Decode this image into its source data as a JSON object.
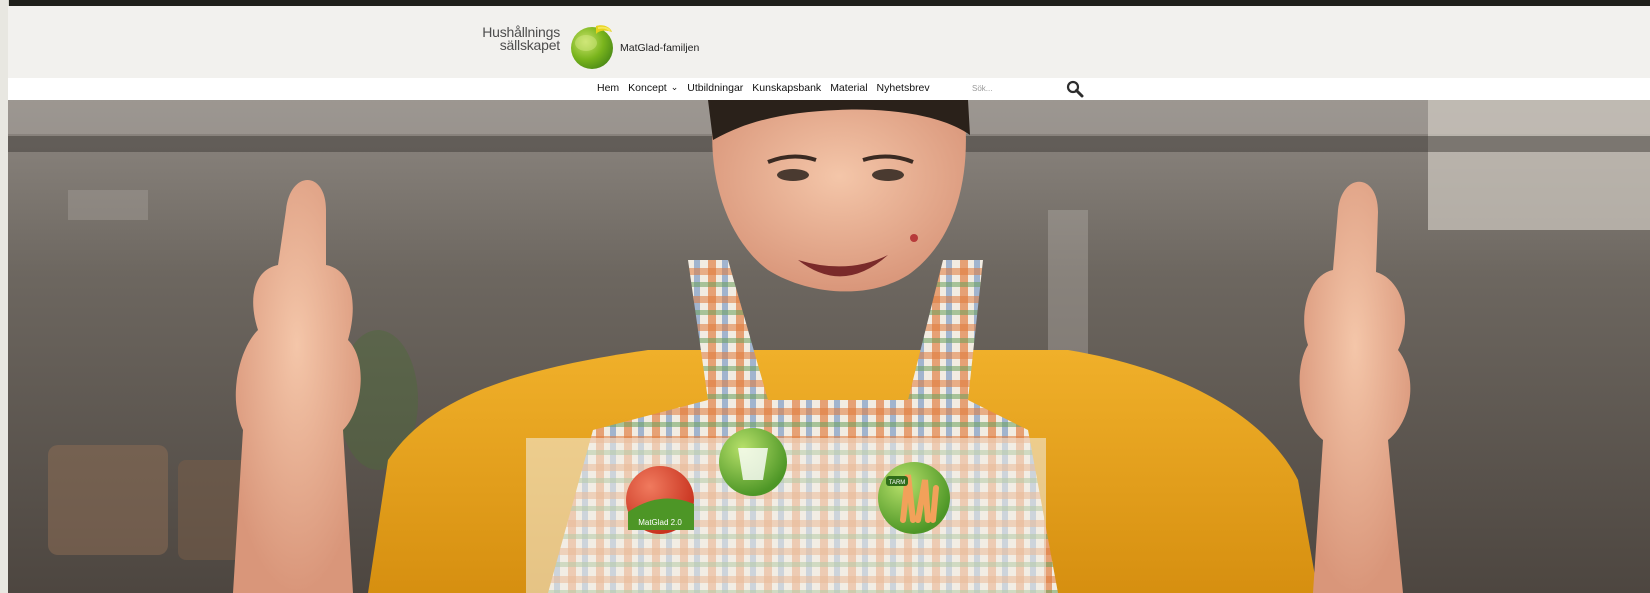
{
  "logo": {
    "org_line1": "Hushållnings",
    "org_line2": "sällskapet",
    "site_name": "MatGlad-familjen"
  },
  "nav": {
    "items": [
      {
        "label": "Hem"
      },
      {
        "label": "Koncept",
        "has_dropdown": true
      },
      {
        "label": "Utbildningar"
      },
      {
        "label": "Kunskapsbank"
      },
      {
        "label": "Material"
      },
      {
        "label": "Nyhetsbrev"
      }
    ],
    "search": {
      "placeholder": "Sök..."
    }
  },
  "hero": {
    "badge_labels": [
      "MatGlad 2.0",
      "TARM"
    ]
  },
  "colors": {
    "page_bg": "#f2f1ee",
    "nav_bg": "#ffffff",
    "logo_green": "#7ab51d",
    "logo_yellow": "#e7d21a",
    "shirt": "#e8a51b",
    "badge_green": "#5ca52f",
    "badge_red": "#d9412b"
  },
  "icons": [
    "search-icon",
    "chevron-down-icon",
    "logo-circle-icon"
  ]
}
